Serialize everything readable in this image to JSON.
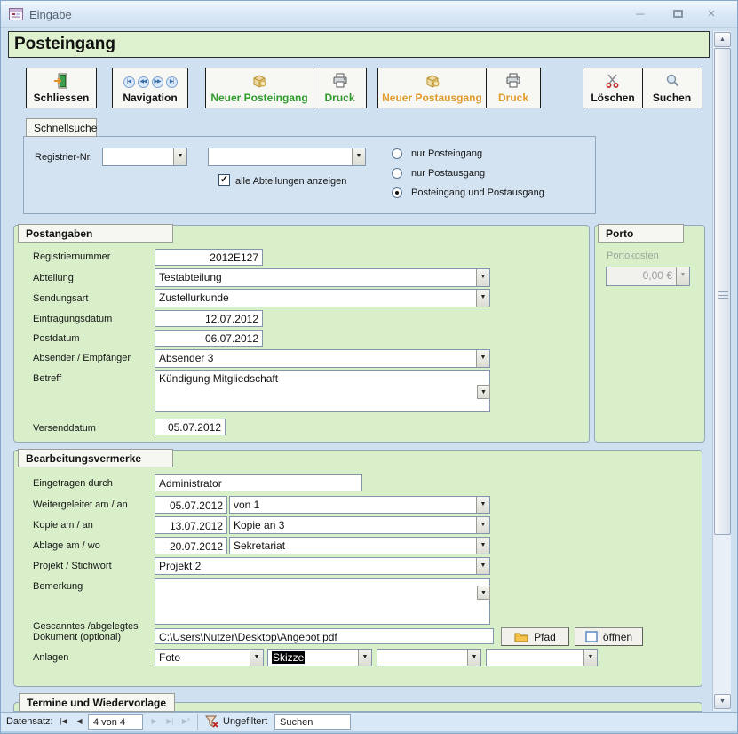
{
  "window": {
    "title": "Eingabe"
  },
  "header": {
    "title": "Posteingang"
  },
  "toolbar": {
    "schliessen": "Schliessen",
    "navigation": "Navigation",
    "neuer_posteingang": "Neuer Posteingang",
    "druck_eingang": "Druck",
    "neuer_postausgang": "Neuer Postausgang",
    "druck_ausgang": "Druck",
    "loeschen": "Löschen",
    "suchen": "Suchen"
  },
  "schnellsuche": {
    "tab": "Schnellsuche",
    "registrier_label": "Registrier-Nr.",
    "combo1_value": "",
    "combo2_value": "",
    "checkbox_label": "alle Abteilungen anzeigen",
    "checkbox_checked": true,
    "radio1": "nur Posteingang",
    "radio2": "nur Postausgang",
    "radio3": "Posteingang und Postausgang",
    "radio_selected": "Posteingang und Postausgang"
  },
  "postangaben": {
    "title": "Postangaben",
    "registriernummer": {
      "label": "Registriernummer",
      "value": "2012E127"
    },
    "abteilung": {
      "label": "Abteilung",
      "value": "Testabteilung"
    },
    "sendungsart": {
      "label": "Sendungsart",
      "value": "Zustellurkunde"
    },
    "eintragungsdatum": {
      "label": "Eintragungsdatum",
      "value": "12.07.2012"
    },
    "postdatum": {
      "label": "Postdatum",
      "value": "06.07.2012"
    },
    "absender": {
      "label": "Absender / Empfänger",
      "value": "Absender 3"
    },
    "betreff": {
      "label": "Betreff",
      "value": "Kündigung Mitgliedschaft"
    },
    "versenddatum": {
      "label": "Versenddatum",
      "value": "05.07.2012"
    }
  },
  "porto": {
    "title": "Porto",
    "portokosten_label": "Portokosten",
    "portokosten_value": "0,00 €"
  },
  "bearbeitung": {
    "title": "Bearbeitungsvermerke",
    "eingetragen": {
      "label": "Eingetragen durch",
      "value": "Administrator"
    },
    "weitergeleitet": {
      "label": "Weitergeleitet am / an",
      "date": "05.07.2012",
      "value": "von 1"
    },
    "kopie": {
      "label": "Kopie am / an",
      "date": "13.07.2012",
      "value": "Kopie an 3"
    },
    "ablage": {
      "label": "Ablage am / wo",
      "date": "20.07.2012",
      "value": "Sekretariat"
    },
    "projekt": {
      "label": "Projekt / Stichwort",
      "value": "Projekt 2"
    },
    "bemerkung": {
      "label": "Bemerkung",
      "value": ""
    },
    "dokument": {
      "label": "Gescanntes /abgelegtes Dokument (optional)",
      "value": "C:\\Users\\Nutzer\\Desktop\\Angebot.pdf",
      "pfad_button": "Pfad",
      "oeffnen_button": "öffnen"
    },
    "anlagen": {
      "label": "Anlagen",
      "values": [
        "Foto",
        "Skizze",
        "",
        ""
      ],
      "selected_index": 1
    }
  },
  "termine": {
    "title": "Termine und Wiedervorlage"
  },
  "statusbar": {
    "datensatz_label": "Datensatz:",
    "record_position": "4 von 4",
    "filter_label": "Ungefiltert",
    "search_text": "Suchen"
  },
  "icons": {
    "dropdown": "▼",
    "check": "✓",
    "up": "▲",
    "down": "▼",
    "minimize": "─",
    "close": "×",
    "nav_first": "|◀",
    "nav_prev": "◀◀",
    "nav_next": "▶▶",
    "nav_last": "▶|",
    "rec_first": "|◀",
    "rec_prev": "◀",
    "rec_next": "▶",
    "rec_last": "▶|",
    "rec_new": "▶*"
  },
  "colors": {
    "form_background": "#cfe0f1",
    "panel_green": "#d9efca",
    "header_green": "#def1ce",
    "accent_green_text": "#2f9b2f",
    "accent_orange_text": "#e09b2d",
    "selection": "#000000",
    "statusbar": "#d9e8f6"
  }
}
